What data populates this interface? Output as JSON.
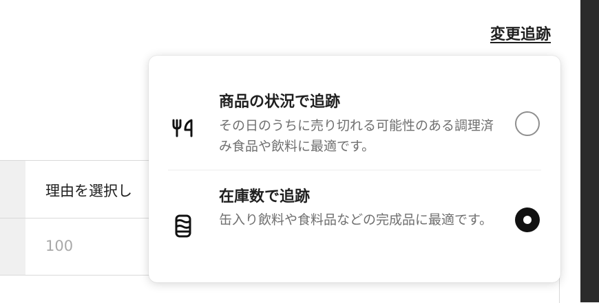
{
  "header": {
    "change_tracking_link": "変更追跡"
  },
  "background_form": {
    "reason_placeholder": "理由を選択し",
    "quantity_value": "100"
  },
  "tracking_menu": {
    "options": [
      {
        "title": "商品の状況で追跡",
        "description": "その日のうちに売り切れる可能性のある調理済み食品や飲料に最適です。",
        "icon": "fork-knife-icon",
        "selected": false
      },
      {
        "title": "在庫数で追跡",
        "description": "缶入り飲料や食料品などの完成品に最適です。",
        "icon": "canned-drink-icon",
        "selected": true
      }
    ]
  },
  "colors": {
    "text_primary": "#1f1f1f",
    "text_secondary": "#6f6f6f",
    "radio_selected": "#111111",
    "right_rail": "#2b2b2b"
  }
}
